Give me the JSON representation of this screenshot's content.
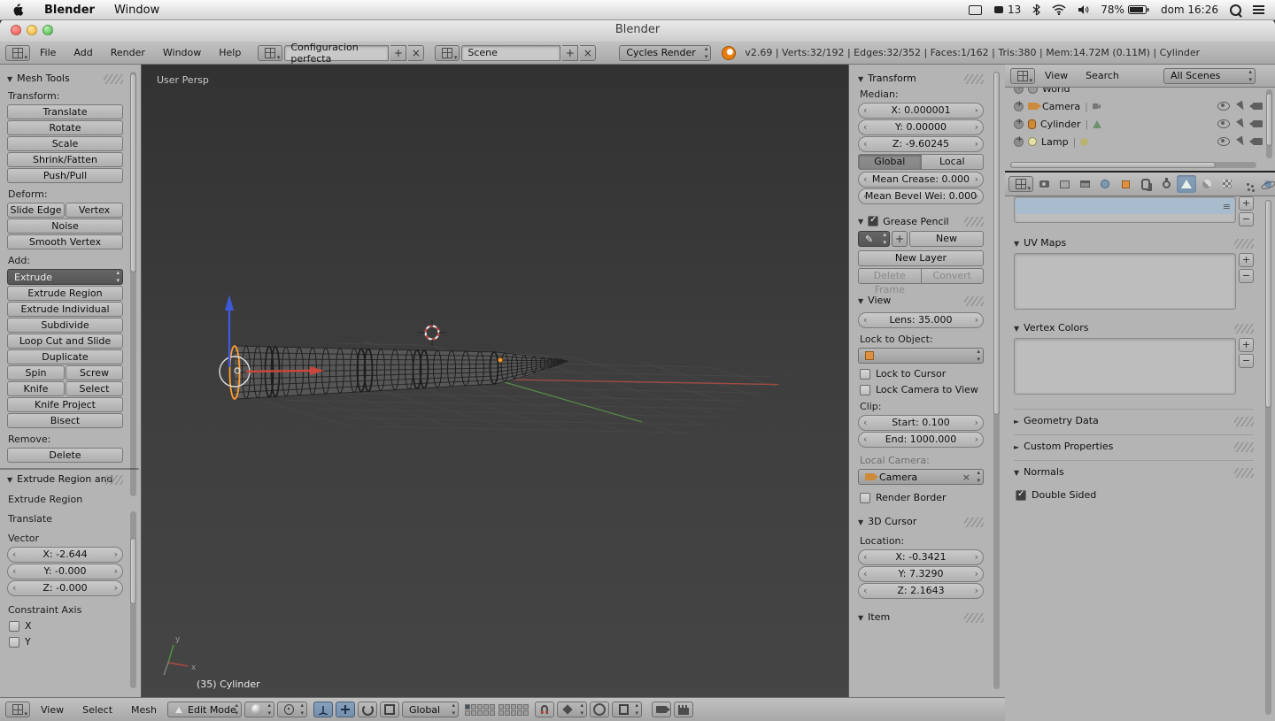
{
  "menubar": {
    "app_name": "Blender",
    "window_menu": "Window",
    "input_badge": "13",
    "battery": "78%",
    "clock": "dom 16:26"
  },
  "titlebar": {
    "title": "Blender"
  },
  "info_header": {
    "menu_file": "File",
    "menu_add": "Add",
    "menu_render": "Render",
    "menu_window": "Window",
    "menu_help": "Help",
    "screen_layout": "Configuracion perfecta",
    "scene": "Scene",
    "engine": "Cycles Render",
    "stats": "v2.69 | Verts:32/192 | Edges:32/352 | Faces:1/162 | Tris:380 | Mem:14.72M (0.11M) | Cylinder"
  },
  "tool_shelf": {
    "panel_mesh_tools": "Mesh Tools",
    "label_transform": "Transform:",
    "btn_translate": "Translate",
    "btn_rotate": "Rotate",
    "btn_scale": "Scale",
    "btn_shrink_fatten": "Shrink/Fatten",
    "btn_push_pull": "Push/Pull",
    "label_deform": "Deform:",
    "btn_slide_edge": "Slide Edge",
    "btn_vertex": "Vertex",
    "btn_noise": "Noise",
    "btn_smooth_vertex": "Smooth Vertex",
    "label_add": "Add:",
    "menu_extrude": "Extrude",
    "btn_extrude_region": "Extrude Region",
    "btn_extrude_individual": "Extrude Individual",
    "btn_subdivide": "Subdivide",
    "btn_loop_cut": "Loop Cut and Slide",
    "btn_duplicate": "Duplicate",
    "btn_spin": "Spin",
    "btn_screw": "Screw",
    "btn_knife": "Knife",
    "btn_select": "Select",
    "btn_knife_project": "Knife Project",
    "btn_bisect": "Bisect",
    "label_remove": "Remove:",
    "btn_delete": "Delete",
    "panel_redo_title": "Extrude Region and",
    "redo_op": "Extrude Region",
    "redo_translate": "Translate",
    "redo_vector": "Vector",
    "redo_x": "X: -2.644",
    "redo_y": "Y: -0.000",
    "redo_z": "Z: -0.000",
    "redo_constraint": "Constraint Axis",
    "redo_axis_x": "X",
    "redo_axis_y": "Y"
  },
  "viewport": {
    "view_label": "User Persp",
    "active_object": "(35) Cylinder",
    "axis_x_label": "x",
    "axis_y_label": "y"
  },
  "view3d_header": {
    "menu_view": "View",
    "menu_select": "Select",
    "menu_mesh": "Mesh",
    "mode": "Edit Mode",
    "orientation": "Global"
  },
  "n_panel": {
    "panel_transform": "Transform",
    "label_median": "Median:",
    "median_x": "X: 0.000001",
    "median_y": "Y: 0.00000",
    "median_z": "Z: -9.60245",
    "btn_global": "Global",
    "btn_local": "Local",
    "mean_crease": "Mean Crease: 0.000",
    "mean_bevel": "Mean Bevel Wei: 0.000",
    "panel_grease_pencil": "Grease Pencil",
    "btn_new": "New",
    "btn_new_layer": "New Layer",
    "btn_delete_frame": "Delete Frame",
    "btn_convert": "Convert",
    "panel_view": "View",
    "lens": "Lens: 35.000",
    "label_lock_to_object": "Lock to Object:",
    "cb_lock_to_cursor": "Lock to Cursor",
    "cb_lock_camera": "Lock Camera to View",
    "label_clip": "Clip:",
    "clip_start": "Start: 0.100",
    "clip_end": "End: 1000.000",
    "label_local_camera": "Local Camera:",
    "camera_value": "Camera",
    "cb_render_border": "Render Border",
    "panel_cursor": "3D Cursor",
    "label_location": "Location:",
    "cursor_x": "X: -0.3421",
    "cursor_y": "Y: 7.3290",
    "cursor_z": "Z: 2.1643",
    "panel_item": "Item"
  },
  "outliner": {
    "menu_view": "View",
    "menu_search": "Search",
    "scope": "All Scenes",
    "item_world": "World",
    "item_camera": "Camera",
    "item_cylinder": "Cylinder",
    "item_lamp": "Lamp"
  },
  "properties": {
    "panel_uv_maps": "UV Maps",
    "panel_vertex_colors": "Vertex Colors",
    "panel_geometry_data": "Geometry Data",
    "panel_custom_properties": "Custom Properties",
    "panel_normals": "Normals",
    "cb_double_sided": "Double Sided"
  },
  "colors": {
    "accent_orange": "#ff9d2e",
    "axis_x_red": "#9e4b43",
    "axis_y_green": "#58854a",
    "axis_z_blue": "#3c59d8",
    "selected_tab_blue": "#7d95b2"
  }
}
